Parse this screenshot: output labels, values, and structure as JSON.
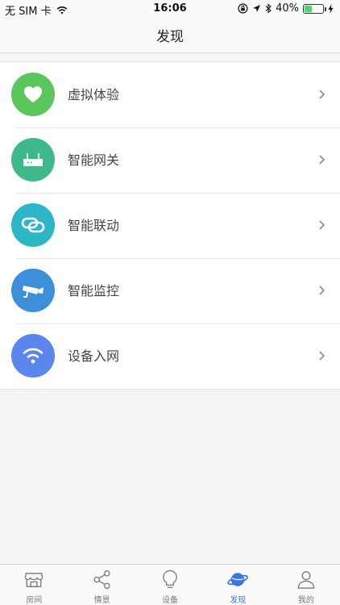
{
  "status_bar": {
    "carrier": "无 SIM 卡",
    "time": "16:06",
    "battery_percent": "40%",
    "battery_level": 0.4,
    "icons": [
      "wifi-icon",
      "lock-rotation-icon",
      "location-arrow-icon",
      "bluetooth-icon",
      "battery-icon",
      "charging-icon"
    ]
  },
  "nav": {
    "title": "发现"
  },
  "list": {
    "items": [
      {
        "label": "虚拟体验",
        "icon": "heart-icon",
        "color": "#5bc65c"
      },
      {
        "label": "智能网关",
        "icon": "router-icon",
        "color": "#3fb98a"
      },
      {
        "label": "智能联动",
        "icon": "link-icon",
        "color": "#2db6c6"
      },
      {
        "label": "智能监控",
        "icon": "camera-icon",
        "color": "#3d8fd9"
      },
      {
        "label": "设备入网",
        "icon": "wifi-icon",
        "color": "#5a86ee"
      }
    ]
  },
  "tab_bar": {
    "tabs": [
      {
        "label": "房间",
        "icon": "store-icon",
        "active": false
      },
      {
        "label": "情景",
        "icon": "share-icon",
        "active": false
      },
      {
        "label": "设备",
        "icon": "bulb-icon",
        "active": false
      },
      {
        "label": "发现",
        "icon": "planet-icon",
        "active": true
      },
      {
        "label": "我的",
        "icon": "person-icon",
        "active": false
      }
    ],
    "active_color": "#3b76e1",
    "inactive_color": "#7a7a7a"
  }
}
